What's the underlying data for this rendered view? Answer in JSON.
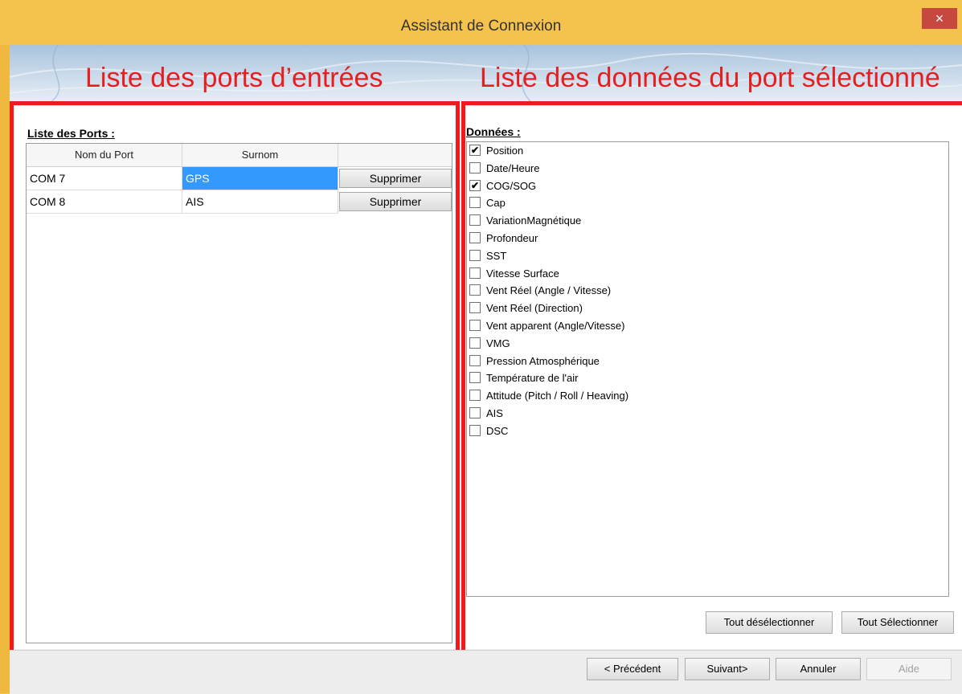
{
  "window": {
    "title": "Assistant de Connexion",
    "close_glyph": "×"
  },
  "annotations": {
    "left_heading": "Liste des ports d’entrées",
    "right_heading": "Liste des données du port sélectionné"
  },
  "ports": {
    "label": "Liste des Ports :",
    "columns": [
      "Nom du Port",
      "Surnom",
      ""
    ],
    "rows": [
      {
        "name": "COM 7",
        "nickname": "GPS",
        "action": "Supprimer",
        "selected": true
      },
      {
        "name": "COM 8",
        "nickname": "AIS",
        "action": "Supprimer",
        "selected": false
      }
    ]
  },
  "data_list": {
    "label": "Données :",
    "items": [
      {
        "label": "Position",
        "checked": true
      },
      {
        "label": "Date/Heure",
        "checked": false
      },
      {
        "label": "COG/SOG",
        "checked": true
      },
      {
        "label": "Cap",
        "checked": false
      },
      {
        "label": "VariationMagnétique",
        "checked": false
      },
      {
        "label": "Profondeur",
        "checked": false
      },
      {
        "label": "SST",
        "checked": false
      },
      {
        "label": "Vitesse Surface",
        "checked": false
      },
      {
        "label": "Vent Réel (Angle / Vitesse)",
        "checked": false
      },
      {
        "label": "Vent Réel (Direction)",
        "checked": false
      },
      {
        "label": "Vent apparent (Angle/Vitesse)",
        "checked": false
      },
      {
        "label": "VMG",
        "checked": false
      },
      {
        "label": "Pression Atmosphérique",
        "checked": false
      },
      {
        "label": "Température de l'air",
        "checked": false
      },
      {
        "label": "Attitude (Pitch / Roll / Heaving)",
        "checked": false
      },
      {
        "label": "AIS",
        "checked": false
      },
      {
        "label": "DSC",
        "checked": false
      }
    ],
    "deselect_all": "Tout désélectionner",
    "select_all": "Tout Sélectionner"
  },
  "nav": {
    "previous": "< Précédent",
    "next": "Suivant>",
    "cancel": "Annuler",
    "help": "Aide"
  },
  "colors": {
    "annotation_red": "#f01a1a",
    "selection_blue": "#3399ff",
    "title_bar": "#f5c24e"
  }
}
